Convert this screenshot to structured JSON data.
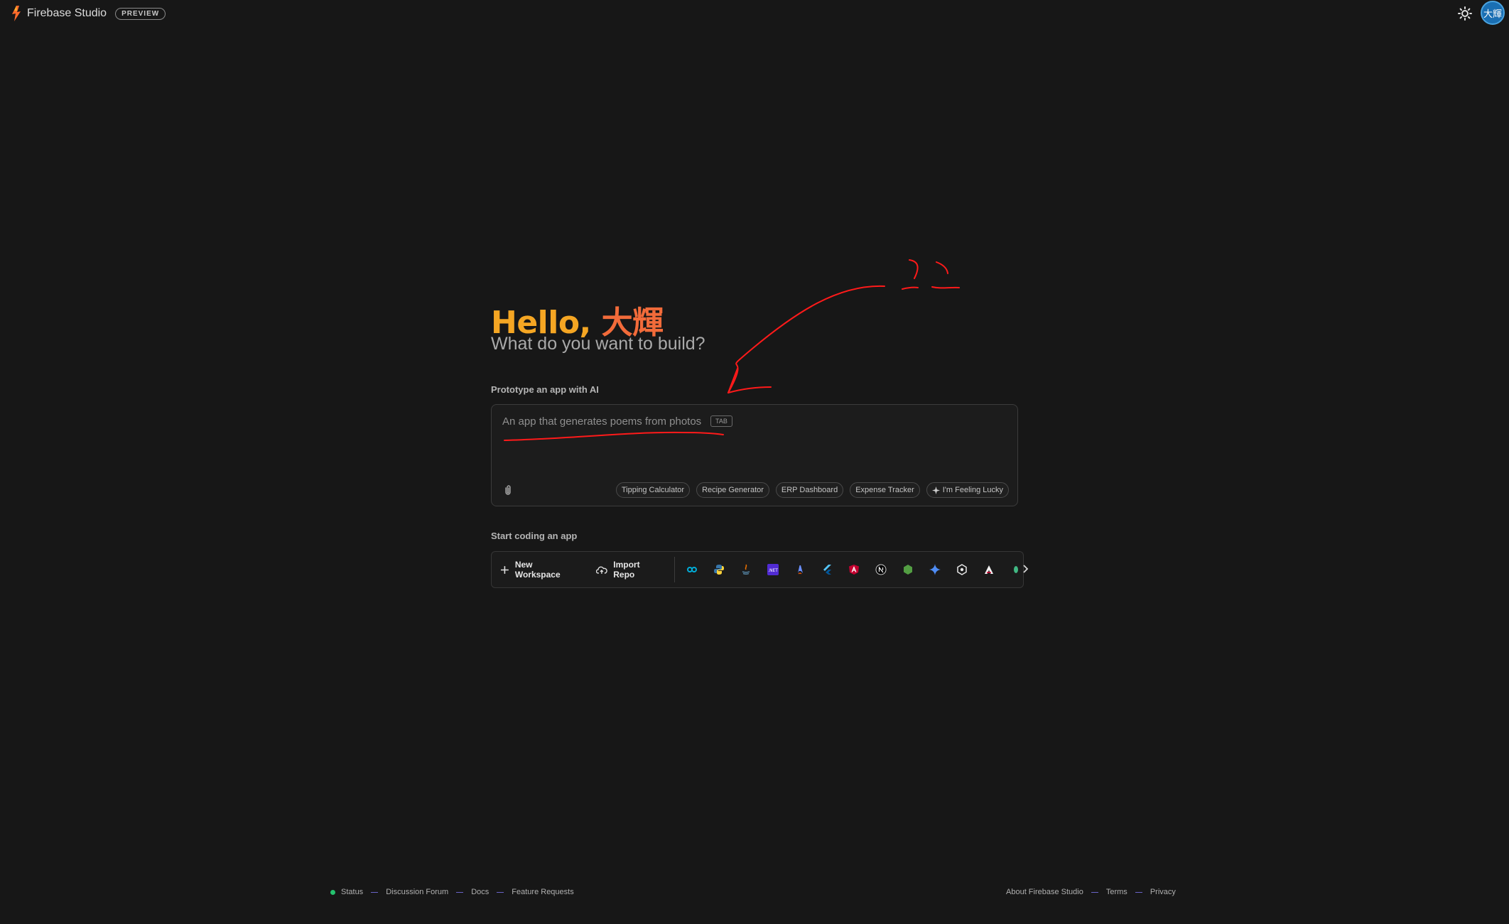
{
  "header": {
    "brand_name": "Firebase Studio",
    "badge": "PREVIEW",
    "avatar_text": "大輝",
    "theme_toggle_icon": "sun-icon"
  },
  "hero": {
    "hello": "Hello, ",
    "name": "大輝",
    "subtitle": "What do you want to build?"
  },
  "prototype": {
    "section_label": "Prototype an app with AI",
    "placeholder": "An app that generates poems from photos",
    "tab_hint": "TAB",
    "attach_icon": "paperclip-icon",
    "chips": [
      {
        "label": "Tipping Calculator"
      },
      {
        "label": "Recipe Generator"
      },
      {
        "label": "ERP Dashboard"
      },
      {
        "label": "Expense Tracker"
      },
      {
        "label": "I'm Feeling Lucky",
        "icon": "sparkle-icon"
      }
    ]
  },
  "coding": {
    "section_label": "Start coding an app",
    "new_workspace": "New Workspace",
    "import_repo": "Import Repo",
    "template_icons": [
      "go-icon",
      "python-icon",
      "java-icon",
      "dotnet-icon",
      "astro-icon",
      "flutter-icon",
      "angular-icon",
      "nextjs-icon",
      "nodejs-icon",
      "gemini-icon",
      "settings-hex-icon",
      "analog-icon",
      "vue-icon"
    ],
    "more_icon": "chevron-right-icon"
  },
  "footer": {
    "left": [
      "Status",
      "Discussion Forum",
      "Docs",
      "Feature Requests"
    ],
    "right": [
      "About Firebase Studio",
      "Terms",
      "Privacy"
    ]
  },
  "colors": {
    "background": "#171717",
    "greeting_start": "#f5a623",
    "greeting_name": "#f26b3a",
    "annotation": "#ff1a1a",
    "status_ok": "#25c26e"
  }
}
